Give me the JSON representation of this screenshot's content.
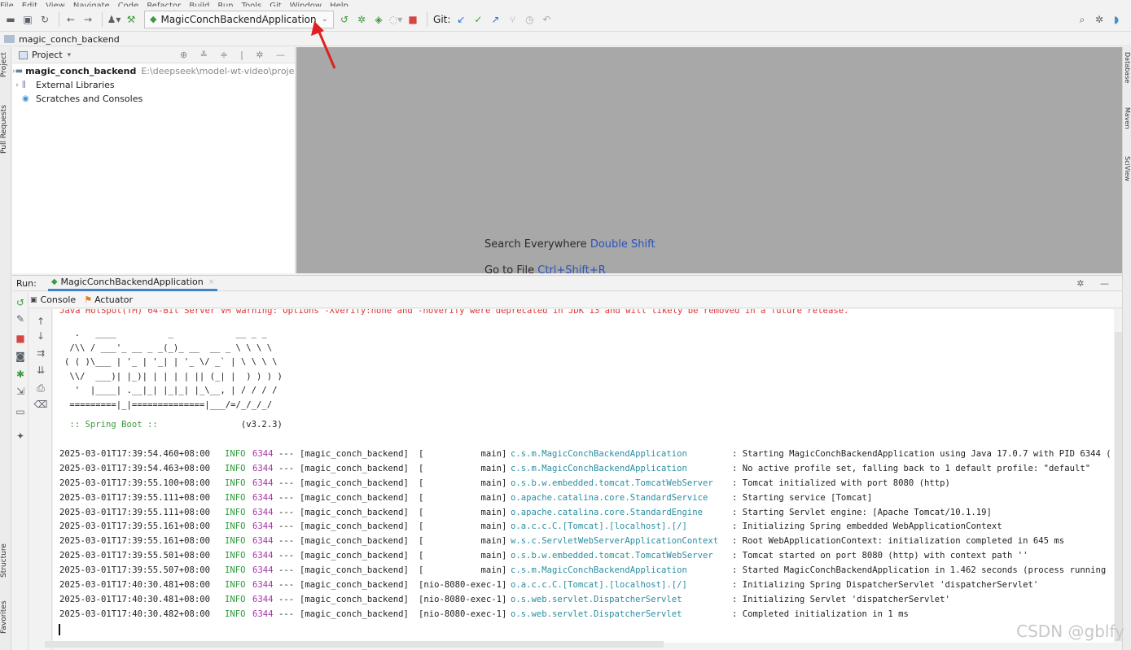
{
  "menu": {
    "items": [
      "File",
      "Edit",
      "View",
      "Navigate",
      "Code",
      "Refactor",
      "Build",
      "Run",
      "Tools",
      "Git",
      "Window",
      "Help"
    ]
  },
  "toolbar": {
    "run_config": "MagicConchBackendApplication",
    "git_label": "Git:"
  },
  "navbar": {
    "breadcrumb": "magic_conch_backend"
  },
  "side_tabs": {
    "project": "Project",
    "pull_requests": "Pull Requests",
    "structure": "Structure",
    "favorites": "Favorites",
    "database": "Database",
    "maven": "Maven",
    "sciview": "SciView"
  },
  "project_panel": {
    "title": "Project",
    "tree": [
      {
        "label": "magic_conch_backend",
        "path": "E:\\deepseek\\model-wt-video\\project\\magi"
      },
      {
        "label": "External Libraries"
      },
      {
        "label": "Scratches and Consoles"
      }
    ]
  },
  "editor": {
    "hint1_text": "Search Everywhere",
    "hint1_key": "Double Shift",
    "hint2_text": "Go to File",
    "hint2_key": "Ctrl+Shift+R"
  },
  "run_panel": {
    "label": "Run:",
    "tab": "MagicConchBackendApplication",
    "console_tab": "Console",
    "actuator_tab": "Actuator"
  },
  "console": {
    "warning": "Java HotSpot(TM) 64-Bit Server VM warning: Options -Xverify:none and -noverify were deprecated in JDK 13 and will likely be removed in a future release.",
    "banner": [
      "  .   ____          _            __ _ _",
      " /\\\\ / ___'_ __ _ _(_)_ __  __ _ \\ \\ \\ \\",
      "( ( )\\___ | '_ | '_| | '_ \\/ _` | \\ \\ \\ \\",
      " \\\\/  ___)| |_)| | | | | || (_| |  ) ) ) )",
      "  '  |____| .__|_| |_|_| |_\\__, | / / / /",
      " =========|_|==============|___/=/_/_/_/"
    ],
    "spring_label": " :: Spring Boot :: ",
    "spring_version": "               (v3.2.3)",
    "logs": [
      {
        "ts": "2025-03-01T17:39:54.460+08:00",
        "lvl": "INFO",
        "pid": "6344",
        "dash": "---",
        "app": "[magic_conch_backend]",
        "thread": "[           main]",
        "logger": "c.s.m.MagicConchBackendApplication",
        "msg": ": Starting MagicConchBackendApplication using Java 17.0.7 with PID 6344 ("
      },
      {
        "ts": "2025-03-01T17:39:54.463+08:00",
        "lvl": "INFO",
        "pid": "6344",
        "dash": "---",
        "app": "[magic_conch_backend]",
        "thread": "[           main]",
        "logger": "c.s.m.MagicConchBackendApplication",
        "msg": ": No active profile set, falling back to 1 default profile: \"default\""
      },
      {
        "ts": "2025-03-01T17:39:55.100+08:00",
        "lvl": "INFO",
        "pid": "6344",
        "dash": "---",
        "app": "[magic_conch_backend]",
        "thread": "[           main]",
        "logger": "o.s.b.w.embedded.tomcat.TomcatWebServer",
        "msg": ": Tomcat initialized with port 8080 (http)"
      },
      {
        "ts": "2025-03-01T17:39:55.111+08:00",
        "lvl": "INFO",
        "pid": "6344",
        "dash": "---",
        "app": "[magic_conch_backend]",
        "thread": "[           main]",
        "logger": "o.apache.catalina.core.StandardService",
        "msg": ": Starting service [Tomcat]"
      },
      {
        "ts": "2025-03-01T17:39:55.111+08:00",
        "lvl": "INFO",
        "pid": "6344",
        "dash": "---",
        "app": "[magic_conch_backend]",
        "thread": "[           main]",
        "logger": "o.apache.catalina.core.StandardEngine",
        "msg": ": Starting Servlet engine: [Apache Tomcat/10.1.19]"
      },
      {
        "ts": "2025-03-01T17:39:55.161+08:00",
        "lvl": "INFO",
        "pid": "6344",
        "dash": "---",
        "app": "[magic_conch_backend]",
        "thread": "[           main]",
        "logger": "o.a.c.c.C.[Tomcat].[localhost].[/]",
        "msg": ": Initializing Spring embedded WebApplicationContext"
      },
      {
        "ts": "2025-03-01T17:39:55.161+08:00",
        "lvl": "INFO",
        "pid": "6344",
        "dash": "---",
        "app": "[magic_conch_backend]",
        "thread": "[           main]",
        "logger": "w.s.c.ServletWebServerApplicationContext",
        "msg": ": Root WebApplicationContext: initialization completed in 645 ms"
      },
      {
        "ts": "2025-03-01T17:39:55.501+08:00",
        "lvl": "INFO",
        "pid": "6344",
        "dash": "---",
        "app": "[magic_conch_backend]",
        "thread": "[           main]",
        "logger": "o.s.b.w.embedded.tomcat.TomcatWebServer",
        "msg": ": Tomcat started on port 8080 (http) with context path ''"
      },
      {
        "ts": "2025-03-01T17:39:55.507+08:00",
        "lvl": "INFO",
        "pid": "6344",
        "dash": "---",
        "app": "[magic_conch_backend]",
        "thread": "[           main]",
        "logger": "c.s.m.MagicConchBackendApplication",
        "msg": ": Started MagicConchBackendApplication in 1.462 seconds (process running"
      },
      {
        "ts": "2025-03-01T17:40:30.481+08:00",
        "lvl": "INFO",
        "pid": "6344",
        "dash": "---",
        "app": "[magic_conch_backend]",
        "thread": "[nio-8080-exec-1]",
        "logger": "o.a.c.c.C.[Tomcat].[localhost].[/]",
        "msg": ": Initializing Spring DispatcherServlet 'dispatcherServlet'"
      },
      {
        "ts": "2025-03-01T17:40:30.481+08:00",
        "lvl": "INFO",
        "pid": "6344",
        "dash": "---",
        "app": "[magic_conch_backend]",
        "thread": "[nio-8080-exec-1]",
        "logger": "o.s.web.servlet.DispatcherServlet",
        "msg": ": Initializing Servlet 'dispatcherServlet'"
      },
      {
        "ts": "2025-03-01T17:40:30.482+08:00",
        "lvl": "INFO",
        "pid": "6344",
        "dash": "---",
        "app": "[magic_conch_backend]",
        "thread": "[nio-8080-exec-1]",
        "logger": "o.s.web.servlet.DispatcherServlet",
        "msg": ": Completed initialization in 1 ms"
      }
    ]
  },
  "watermark": "CSDN @gblfy",
  "colors": {
    "accent": "#4083c9",
    "run_green": "#3e9a3e",
    "stop_red": "#d64545",
    "log_info": "#2e9b3c",
    "log_pid": "#a636a6",
    "log_logger": "#2a8ea0",
    "annotation_arrow": "#e02020"
  }
}
